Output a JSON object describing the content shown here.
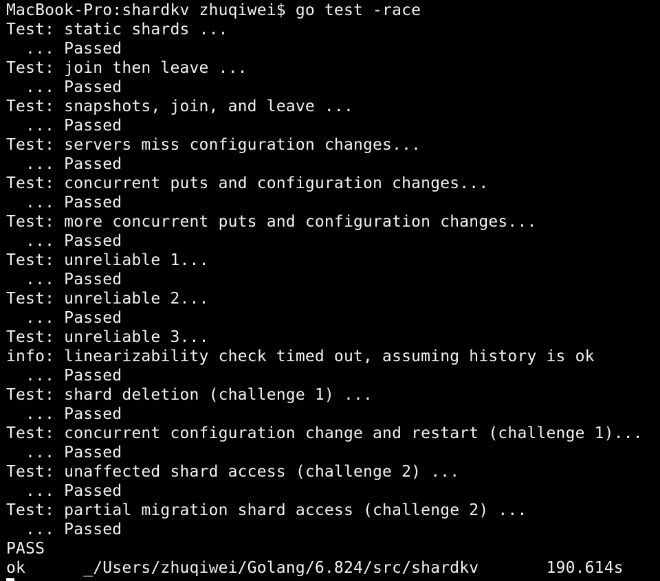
{
  "colors": {
    "background": "#000000",
    "foreground": "#f2f2f2",
    "cursor": "#ffffff"
  },
  "terminal": {
    "lines": [
      "MacBook-Pro:shardkv zhuqiwei$ go test -race",
      "Test: static shards ...",
      "  ... Passed",
      "Test: join then leave ...",
      "  ... Passed",
      "Test: snapshots, join, and leave ...",
      "  ... Passed",
      "Test: servers miss configuration changes...",
      "  ... Passed",
      "Test: concurrent puts and configuration changes...",
      "  ... Passed",
      "Test: more concurrent puts and configuration changes...",
      "  ... Passed",
      "Test: unreliable 1...",
      "  ... Passed",
      "Test: unreliable 2...",
      "  ... Passed",
      "Test: unreliable 3...",
      "info: linearizability check timed out, assuming history is ok",
      "  ... Passed",
      "Test: shard deletion (challenge 1) ...",
      "  ... Passed",
      "Test: concurrent configuration change and restart (challenge 1)...",
      "  ... Passed",
      "Test: unaffected shard access (challenge 2) ...",
      "  ... Passed",
      "Test: partial migration shard access (challenge 2) ...",
      "  ... Passed",
      "PASS",
      "ok  \t_/Users/zhuqiwei/Golang/6.824/src/shardkv\t190.614s"
    ]
  }
}
